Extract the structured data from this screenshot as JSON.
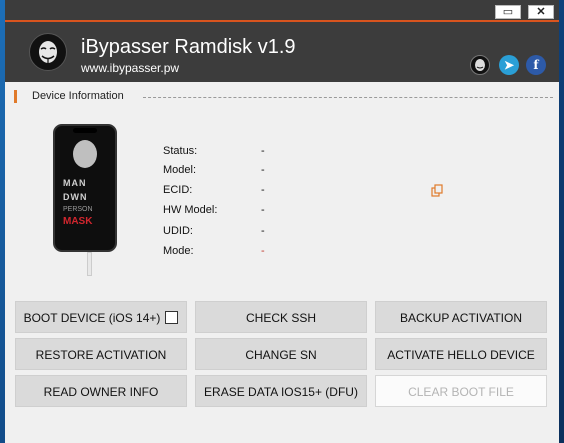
{
  "window": {
    "controls": {
      "minimize": "▭",
      "close": "✕"
    },
    "title": "iBypasser Ramdisk v1.9",
    "url": "www.ibypasser.pw",
    "social": [
      "anonymous-logo",
      "telegram",
      "facebook"
    ],
    "social_glyphs": {
      "telegram": "➤",
      "facebook": "f"
    },
    "accent_color": "#d9541e"
  },
  "device_info": {
    "section_title": "Device Information",
    "phone_wallpaper": {
      "line1": "MAN",
      "line2": "DWN",
      "line3": "PERSON",
      "line4": "MASK"
    },
    "fields": [
      {
        "label": "Status:",
        "value": "-"
      },
      {
        "label": "Model:",
        "value": "-"
      },
      {
        "label": "ECID:",
        "value": "-"
      },
      {
        "label": "HW Model:",
        "value": "-"
      },
      {
        "label": "UDID:",
        "value": "-"
      },
      {
        "label": "Mode:",
        "value": "-"
      }
    ],
    "copy_icon": "copy-icon"
  },
  "buttons": {
    "boot_device": "BOOT DEVICE (iOS 14+)",
    "check_ssh": "CHECK SSH",
    "backup_activation": "BACKUP ACTIVATION",
    "restore_activation": "RESTORE ACTIVATION",
    "change_sn": "CHANGE SN",
    "activate_hello": "ACTIVATE HELLO DEVICE",
    "read_owner": "READ OWNER INFO",
    "erase_data": "ERASE DATA IOS15+ (DFU)",
    "clear_boot": "CLEAR BOOT FILE"
  }
}
